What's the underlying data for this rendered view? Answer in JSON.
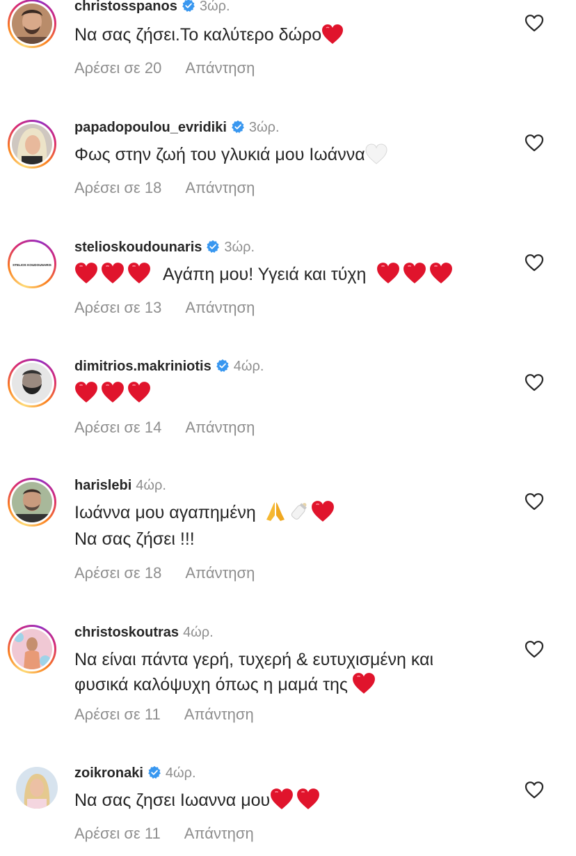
{
  "comments": [
    {
      "username": "christosspanos",
      "verified": true,
      "time": "3ώρ.",
      "lines": [
        "Να σας ζήσει.Το καλύτερο δώρο"
      ],
      "likes": "Αρέσει σε 20",
      "reply": "Απάντηση"
    },
    {
      "username": "papadopoulou_evridiki",
      "verified": true,
      "time": "3ώρ.",
      "lines": [
        "Φως στην ζωή του γλυκιά μου Ιωάννα"
      ],
      "likes": "Αρέσει σε 18",
      "reply": "Απάντηση"
    },
    {
      "username": "stelioskoudounaris",
      "verified": true,
      "time": "3ώρ.",
      "lines": [
        "Αγάπη μου! Υγειά και τύχη"
      ],
      "likes": "Αρέσει σε 13",
      "reply": "Απάντηση",
      "avatar_text": "STELIOS KOUDOUNARIS"
    },
    {
      "username": "dimitrios.makriniotis",
      "verified": true,
      "time": "4ώρ.",
      "lines": [
        ""
      ],
      "likes": "Αρέσει σε 14",
      "reply": "Απάντηση"
    },
    {
      "username": "harislebi",
      "verified": false,
      "time": "4ώρ.",
      "lines": [
        "Ιωάννα μου αγαπημένη",
        "Να σας ζήσει !!!"
      ],
      "likes": "Αρέσει σε 18",
      "reply": "Απάντηση"
    },
    {
      "username": "christoskoutras",
      "verified": false,
      "time": "4ώρ.",
      "lines": [
        "Να είναι πάντα γερή, τυχερή & ευτυχισμένη και",
        "φυσικά καλόψυχη όπως η μαμά της"
      ],
      "likes": "Αρέσει σε 11",
      "reply": "Απάντηση"
    },
    {
      "username": "zoikronaki",
      "verified": true,
      "time": "4ώρ.",
      "lines": [
        "Να σας ζησει Ιωαννα μου"
      ],
      "likes": "Αρέσει σε 11",
      "reply": "Απάντηση"
    }
  ],
  "icons": {
    "like": "heart-outline-icon",
    "verified": "verified-badge-icon",
    "emoji_heart": "red-heart-emoji",
    "emoji_white_heart": "white-heart-emoji",
    "emoji_pray": "folded-hands-emoji",
    "emoji_bottle": "baby-bottle-emoji"
  },
  "colors": {
    "username": "#262626",
    "secondary": "#8e8e8e",
    "verified": "#3897f0",
    "heart": "#e0142c"
  }
}
